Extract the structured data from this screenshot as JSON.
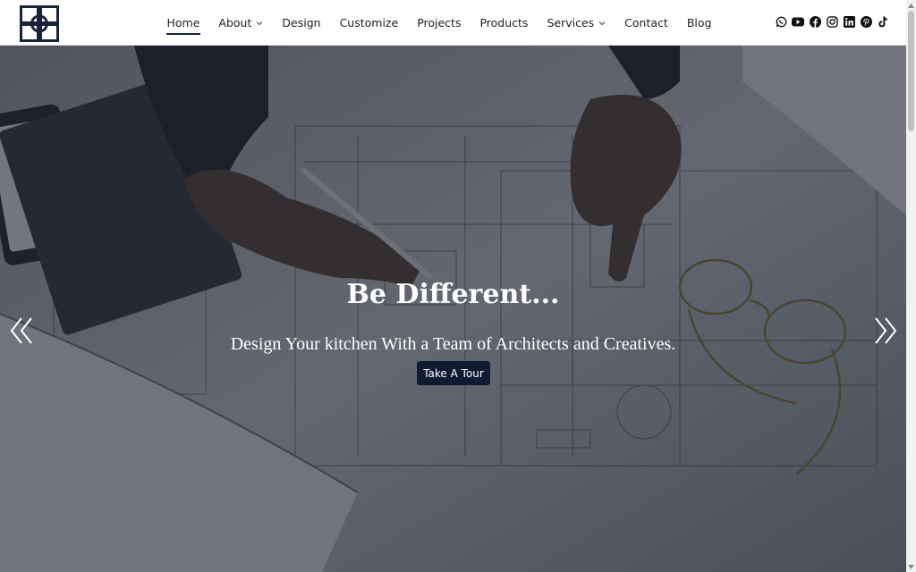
{
  "header": {
    "logo_name": "brand-logo",
    "nav": [
      {
        "label": "Home",
        "active": true,
        "dropdown": false
      },
      {
        "label": "About",
        "active": false,
        "dropdown": true
      },
      {
        "label": "Design",
        "active": false,
        "dropdown": false
      },
      {
        "label": "Customize",
        "active": false,
        "dropdown": false
      },
      {
        "label": "Projects",
        "active": false,
        "dropdown": false
      },
      {
        "label": "Products",
        "active": false,
        "dropdown": false
      },
      {
        "label": "Services",
        "active": false,
        "dropdown": true
      },
      {
        "label": "Contact",
        "active": false,
        "dropdown": false
      },
      {
        "label": "Blog",
        "active": false,
        "dropdown": false
      }
    ],
    "social_icons": [
      "whatsapp-icon",
      "youtube-icon",
      "facebook-icon",
      "instagram-icon",
      "linkedin-icon",
      "pinterest-icon",
      "tiktok-icon"
    ]
  },
  "hero": {
    "title": "Be Different...",
    "subtitle": "Design Your kitchen With a Team of Architects and Creatives.",
    "cta_label": "Take A Tour",
    "prev_icon": "chevron-double-left-icon",
    "next_icon": "chevron-double-right-icon"
  },
  "colors": {
    "brand": "#17233a",
    "cta_bg": "#0f1b30",
    "overlay": "#141822"
  }
}
